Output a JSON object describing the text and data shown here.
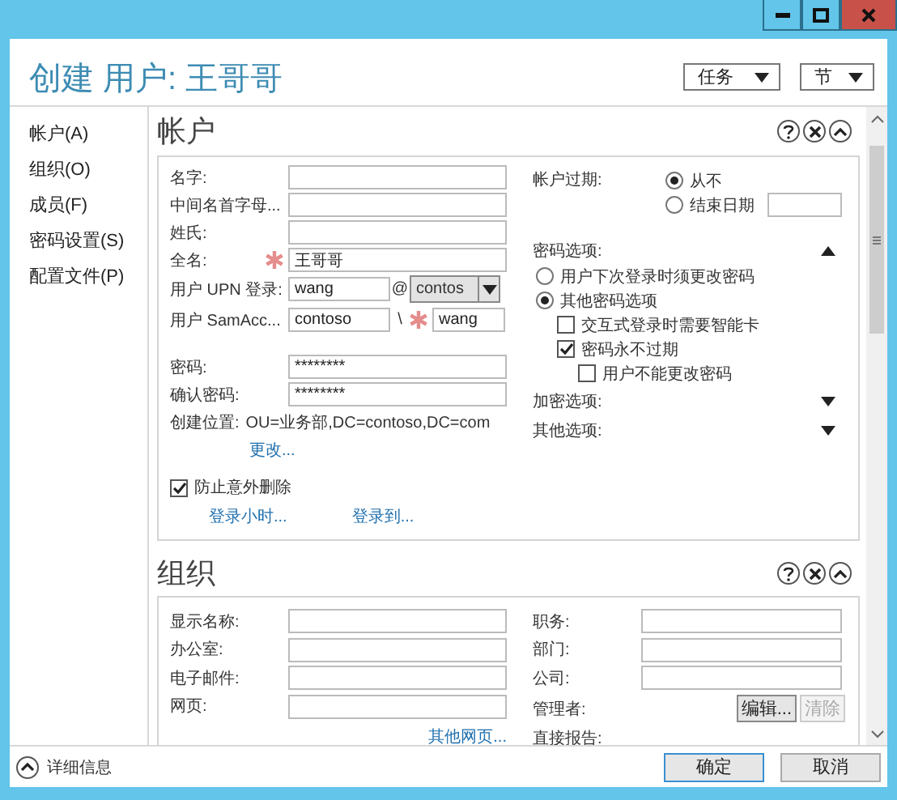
{
  "window": {
    "title": "创建 用户: 王哥哥"
  },
  "header_menus": [
    {
      "label": "任务"
    },
    {
      "label": "节"
    }
  ],
  "sidebar": {
    "items": [
      {
        "label": "帐户(A)"
      },
      {
        "label": "组织(O)"
      },
      {
        "label": "成员(F)"
      },
      {
        "label": "密码设置(S)"
      },
      {
        "label": "配置文件(P)"
      }
    ]
  },
  "account": {
    "title": "帐户",
    "fields": [
      {
        "kind": "text",
        "label": "名字:",
        "required": false
      },
      {
        "kind": "text",
        "label": "中间名首字母...",
        "required": false
      },
      {
        "kind": "text",
        "label": "姓氏:",
        "required": false
      },
      {
        "kind": "text",
        "label": "全名:",
        "value": "王哥哥",
        "required": true
      },
      {
        "kind": "upn",
        "label": "用户 UPN 登录:",
        "value": "wang",
        "separator": "@",
        "domain": "contos",
        "required": false
      },
      {
        "kind": "sam",
        "label": "用户 SamAcc...",
        "domain": "contoso",
        "separator": "\\",
        "value": "wang",
        "required": true
      }
    ],
    "password_fields": [
      {
        "label": "密码:",
        "value": "********"
      },
      {
        "label": "确认密码:",
        "value": "********"
      }
    ],
    "location": {
      "label": "创建位置:",
      "value": "OU=业务部,DC=contoso,DC=com",
      "link": "更改..."
    },
    "protect": {
      "label": "防止意外删除",
      "checked": true
    },
    "links": [
      "登录小时...",
      "登录到..."
    ],
    "expiry": {
      "label": "帐户过期:",
      "options": [
        {
          "label": "从不",
          "selected": true
        },
        {
          "label": "结束日期",
          "selected": false
        }
      ]
    },
    "password_options": {
      "label": "密码选项:",
      "expanded": true,
      "radios": [
        {
          "label": "用户下次登录时须更改密码",
          "selected": false
        },
        {
          "label": "其他密码选项",
          "selected": true
        }
      ],
      "checks": [
        {
          "label": "交互式登录时需要智能卡",
          "checked": false
        },
        {
          "label": "密码永不过期",
          "checked": true,
          "children": [
            {
              "label": "用户不能更改密码",
              "checked": false
            }
          ]
        }
      ]
    },
    "more": [
      {
        "label": "加密选项:",
        "expanded": false
      },
      {
        "label": "其他选项:",
        "expanded": false
      }
    ]
  },
  "organization": {
    "title": "组织",
    "left_fields": [
      {
        "label": "显示名称:"
      },
      {
        "label": "办公室:"
      },
      {
        "label": "电子邮件:"
      },
      {
        "label": "网页:"
      }
    ],
    "link": "其他网页...",
    "right_fields": [
      {
        "label": "职务:"
      },
      {
        "label": "部门:"
      },
      {
        "label": "公司:"
      }
    ],
    "manager": {
      "label": "管理者:",
      "buttons": [
        {
          "label": "编辑...",
          "disabled": false
        },
        {
          "label": "清除",
          "disabled": true
        }
      ]
    },
    "reports": {
      "label": "直接报告:"
    }
  },
  "footer": {
    "details": "详细信息",
    "buttons": [
      {
        "label": "确定",
        "default": true
      },
      {
        "label": "取消",
        "default": false
      }
    ]
  }
}
